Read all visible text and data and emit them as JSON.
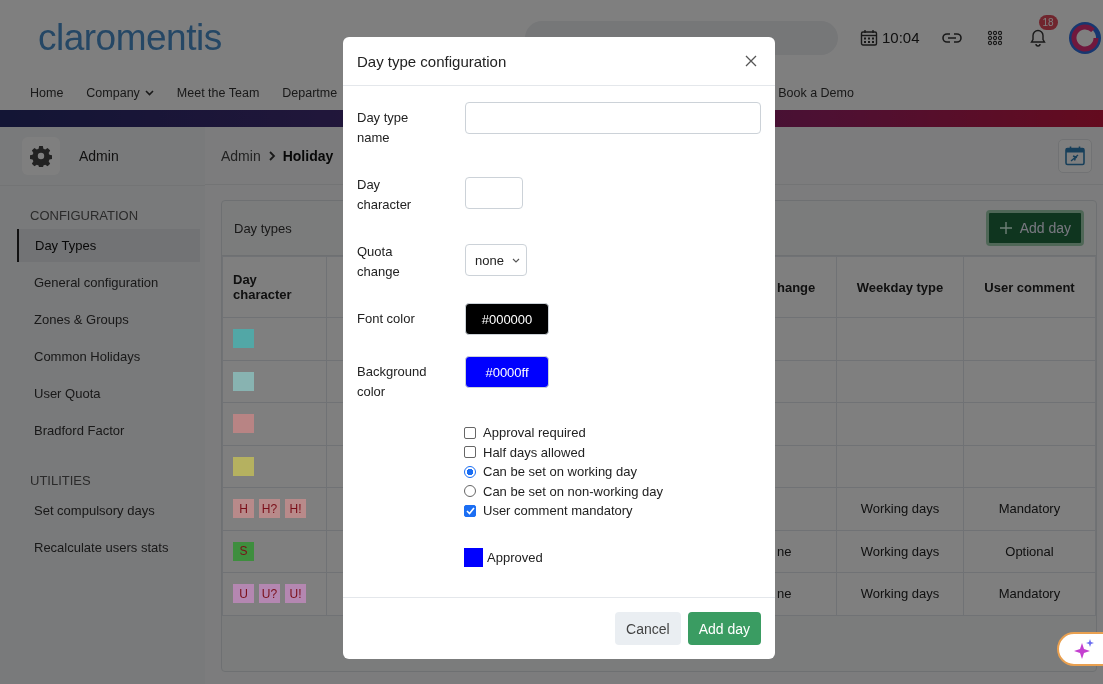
{
  "header": {
    "logo": "claromentis",
    "time": "10:04",
    "notification_count": "18"
  },
  "nav": [
    {
      "label": "Home",
      "has_menu": false
    },
    {
      "label": "Company",
      "has_menu": true
    },
    {
      "label": "Meet the Team",
      "has_menu": false
    },
    {
      "label": "Departme",
      "has_menu": false
    },
    {
      "label": "Book a Demo",
      "has_menu": false
    }
  ],
  "sidebar": {
    "title": "Admin",
    "sections": [
      {
        "title": "CONFIGURATION",
        "items": [
          {
            "label": "Day Types",
            "selected": true
          },
          {
            "label": "General configuration",
            "selected": false
          },
          {
            "label": "Zones & Groups",
            "selected": false
          },
          {
            "label": "Common Holidays",
            "selected": false
          },
          {
            "label": "User Quota",
            "selected": false
          },
          {
            "label": "Bradford Factor",
            "selected": false
          }
        ]
      },
      {
        "title": "UTILITIES",
        "items": [
          {
            "label": "Set compulsory days",
            "selected": false
          },
          {
            "label": "Recalculate users stats",
            "selected": false
          }
        ]
      }
    ]
  },
  "breadcrumb": [
    "Admin",
    "Holiday"
  ],
  "card": {
    "title": "Day types",
    "add_button": "Add day"
  },
  "table": {
    "columns": {
      "day_character": "Day character",
      "change": "hange",
      "weekday": "Weekday type",
      "comment": "User comment"
    },
    "rows": [
      {
        "chars": [
          {
            "color": "#52a7a6"
          }
        ]
      },
      {
        "chars": [
          {
            "color": "#88b3b1"
          }
        ]
      },
      {
        "chars": [
          {
            "color": "#b88484"
          }
        ]
      },
      {
        "chars": [
          {
            "color": "#b5b160"
          }
        ]
      },
      {
        "chars": [
          {
            "text": "H",
            "color": "#b88a8a"
          },
          {
            "text": "H?",
            "color": "#b88a8a"
          },
          {
            "text": "H!",
            "color": "#b88a8a"
          }
        ],
        "weekday": "Working days",
        "comment": "Mandatory"
      },
      {
        "chars": [
          {
            "text": "S",
            "color": "#3e8e3e"
          }
        ],
        "change": "ne",
        "weekday": "Working days",
        "comment": "Optional"
      },
      {
        "chars": [
          {
            "text": "U",
            "color": "#b487b1"
          },
          {
            "text": "U?",
            "color": "#b487b1"
          },
          {
            "text": "U!",
            "color": "#b487b1"
          }
        ],
        "change": "ne",
        "weekday": "Working days",
        "comment": "Mandatory"
      }
    ]
  },
  "modal": {
    "title": "Day type configuration",
    "fields": [
      {
        "kind": "text",
        "label": "Day type name"
      },
      {
        "kind": "short",
        "label": "Day character"
      },
      {
        "kind": "select",
        "label": "Quota change",
        "value": "none"
      },
      {
        "kind": "color",
        "label": "Font color",
        "value": "#000000",
        "color": "#000000"
      },
      {
        "kind": "color",
        "label": "Background color",
        "value": "#0000ff",
        "color": "#0000ff"
      }
    ],
    "options": [
      {
        "kind": "checkbox",
        "label": "Approval required",
        "checked": false
      },
      {
        "kind": "checkbox",
        "label": "Half days allowed",
        "checked": false
      },
      {
        "kind": "radio",
        "label": "Can be set on working day",
        "selected": true
      },
      {
        "kind": "radio",
        "label": "Can be set on non-working day",
        "selected": false
      },
      {
        "kind": "checkbox",
        "label": "User comment mandatory",
        "checked": true
      }
    ],
    "preview": {
      "label": "Approved",
      "color": "#0000ff"
    },
    "buttons": {
      "cancel": "Cancel",
      "submit": "Add day"
    }
  }
}
